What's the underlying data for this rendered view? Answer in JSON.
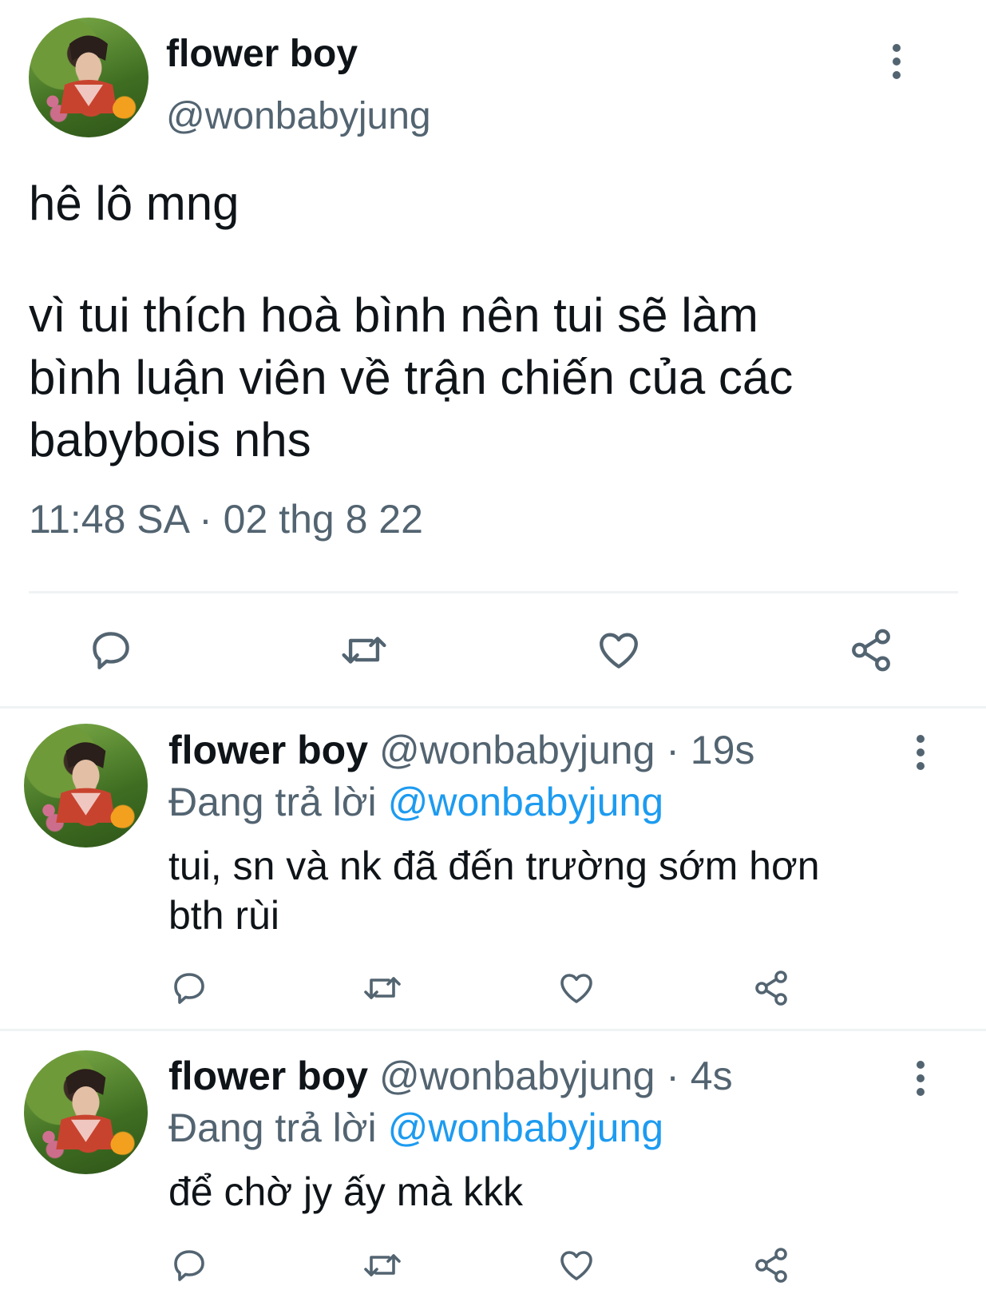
{
  "main_tweet": {
    "display_name": "flower boy",
    "handle": "@wonbabyjung",
    "text_line1": "hê lô mng",
    "text_line2": "vì tui thích hoà bình nên tui sẽ làm",
    "text_line3": "bình luận viên về trận chiến của các",
    "text_line4": "babybois nhs",
    "timestamp": "11:48 SA · 02 thg 8 22"
  },
  "replies": [
    {
      "display_name": "flower boy",
      "handle_time": "@wonbabyjung · 19s",
      "replying_label": "Đang trả lời",
      "replying_to": "@wonbabyjung",
      "text_line1": "tui, sn và nk đã đến trường sớm hơn",
      "text_line2": "bth rùi"
    },
    {
      "display_name": "flower boy",
      "handle_time": "@wonbabyjung · 4s",
      "replying_label": "Đang trả lời",
      "replying_to": "@wonbabyjung",
      "text_line1": "để chờ jy ấy mà kkk"
    }
  ],
  "icons": [
    "reply-icon",
    "retweet-icon",
    "like-icon",
    "share-icon",
    "more-icon"
  ],
  "colors": {
    "text": "#0f1419",
    "secondary": "#536471",
    "accent": "#1d9bf0",
    "divider": "#eff3f4"
  }
}
